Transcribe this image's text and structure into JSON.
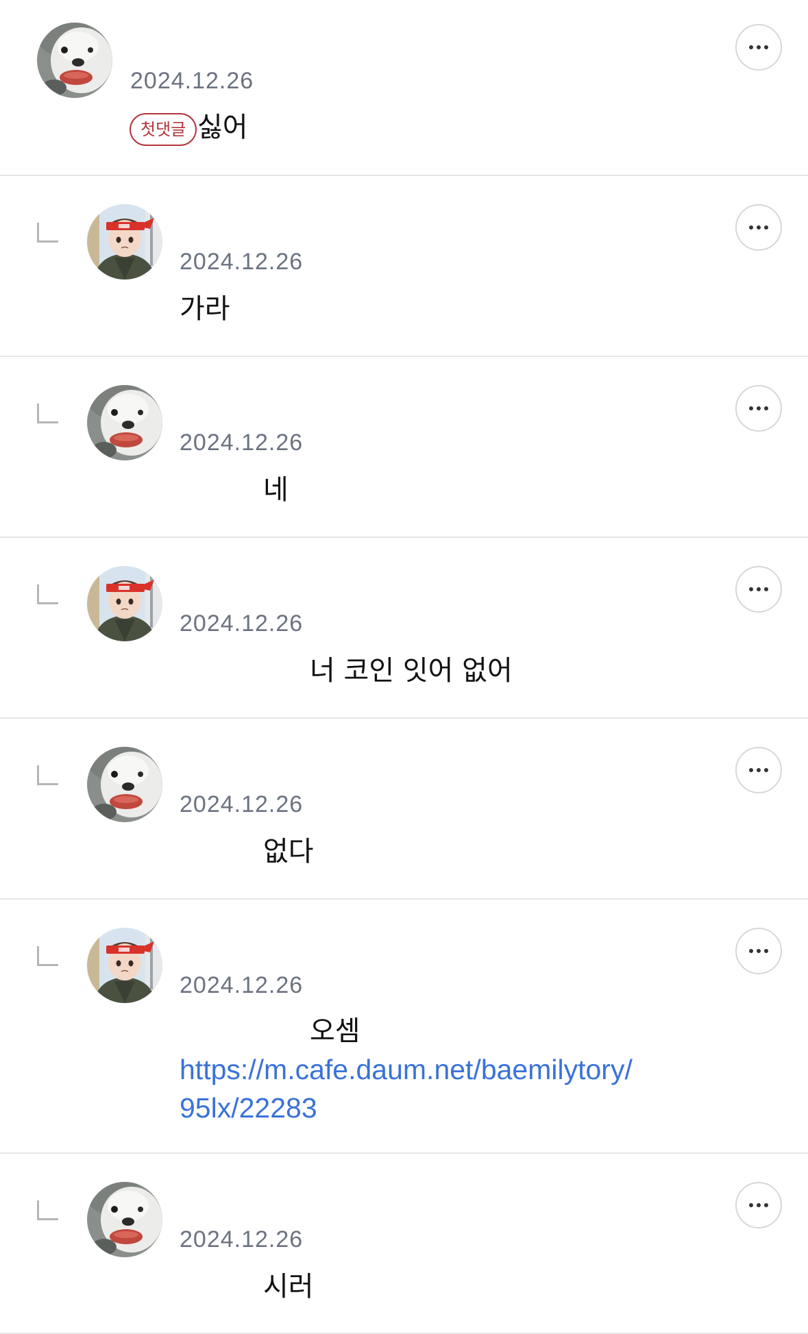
{
  "more_icon": "more-horizontal-icon",
  "reply_icon": "reply-indent-icon",
  "colors": {
    "link": "#3a72d8",
    "badge": "#b3343b",
    "date": "#6b7280",
    "divider": "#e6e6e6"
  },
  "comments": [
    {
      "avatar": "white-dog-avatar",
      "date": "2024.12.26",
      "badge": "첫댓글",
      "text": "싫어"
    },
    {
      "avatar": "cartoon-boy-headband-avatar",
      "date": "2024.12.26",
      "text": "가라"
    },
    {
      "avatar": "white-dog-avatar",
      "date": "2024.12.26",
      "text": "네"
    },
    {
      "avatar": "cartoon-boy-headband-avatar",
      "date": "2024.12.26",
      "text": "너 코인 잇어 없어"
    },
    {
      "avatar": "white-dog-avatar",
      "date": "2024.12.26",
      "text": "없다"
    },
    {
      "avatar": "cartoon-boy-headband-avatar",
      "date": "2024.12.26",
      "text": "오셈",
      "link_line1": "https://m.cafe.daum.net/baemilytory/",
      "link_line2": "95lx/22283"
    },
    {
      "avatar": "white-dog-avatar",
      "date": "2024.12.26",
      "text": "시러"
    }
  ]
}
